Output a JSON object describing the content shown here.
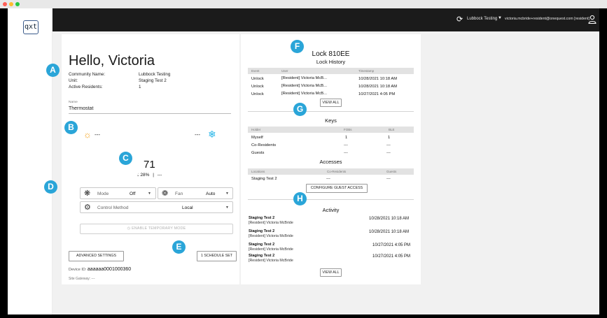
{
  "topbar": {
    "community": "Lubbock Testing",
    "user": "victoria.mcbride+resident@onequest.com [resident]"
  },
  "logo": "qxt",
  "greeting": "Hello, Victoria",
  "info": {
    "community_label": "Community Name:",
    "community_value": "Lubbock Testing",
    "unit_label": "Unit:",
    "unit_value": "Staging Test 2",
    "residents_label": "Active Residents:",
    "residents_value": "1"
  },
  "name_field": {
    "label": "Name",
    "value": "Thermostat"
  },
  "thermostat": {
    "heat_setpoint": "---",
    "cool_setpoint": "---",
    "temperature": "71",
    "humidity": "28%",
    "humidity_sep": "|",
    "humidity_extra": "---",
    "mode_label": "Mode",
    "mode_value": "Off",
    "fan_label": "Fan",
    "fan_value": "Auto",
    "control_label": "Control Method",
    "control_value": "Local",
    "enable_temp_mode": "ENABLE TEMPORARY MODE",
    "advanced_settings": "ADVANCED SETTINGS",
    "schedule": "1 SCHEDULE SET",
    "device_id_label": "Device ID:",
    "device_id_value": "aaaaaa0001000360",
    "site_gateway": "Site Gateway: ---"
  },
  "lock": {
    "title": "Lock 810EE",
    "history_title": "Lock History",
    "columns": [
      "Event",
      "User",
      "Timestamp"
    ],
    "rows": [
      {
        "event": "Unlock",
        "user": "[Resident] Victoria McB...",
        "ts": "10/28/2021 10:18 AM"
      },
      {
        "event": "Unlock",
        "user": "[Resident] Victoria McB...",
        "ts": "10/28/2021 10:18 AM"
      },
      {
        "event": "Unlock",
        "user": "[Resident] Victoria McB...",
        "ts": "10/27/2021 4:05 PM"
      }
    ],
    "view_all": "VIEW ALL"
  },
  "keys": {
    "title": "Keys",
    "columns": [
      "Holder",
      "FOBs",
      "BLE"
    ],
    "rows": [
      {
        "holder": "Myself",
        "fobs": "1",
        "ble": "1"
      },
      {
        "holder": "Co-Residents",
        "fobs": "---",
        "ble": "---"
      },
      {
        "holder": "Guests",
        "fobs": "---",
        "ble": "---"
      }
    ]
  },
  "accesses": {
    "title": "Accesses",
    "columns": [
      "Locations",
      "Co-Residents",
      "Guests"
    ],
    "rows": [
      {
        "location": "Staging Test 2",
        "co": "---",
        "guests": "---"
      }
    ],
    "configure": "CONFIGURE GUEST ACCESS"
  },
  "activity": {
    "title": "Activity",
    "items": [
      {
        "place": "Staging Test 2",
        "who": "[Resident] Victoria McBride",
        "ts": "10/28/2021 10:18 AM"
      },
      {
        "place": "Staging Test 2",
        "who": "[Resident] Victoria McBride",
        "ts": "10/28/2021 10:18 AM"
      },
      {
        "place": "Staging Test 2",
        "who": "[Resident] Victoria McBride",
        "ts": "10/27/2021 4:05 PM"
      },
      {
        "place": "Staging Test 2",
        "who": "[Resident] Victoria McBride",
        "ts": "10/27/2021 4:05 PM"
      }
    ],
    "view_all": "VIEW ALL"
  },
  "markers": [
    "A",
    "B",
    "C",
    "D",
    "E",
    "F",
    "G",
    "H"
  ],
  "colors": {
    "marker": "#2aa5d8",
    "heat": "#f5a623",
    "cool": "#29b6e8",
    "topbar": "#1b1b1b"
  }
}
